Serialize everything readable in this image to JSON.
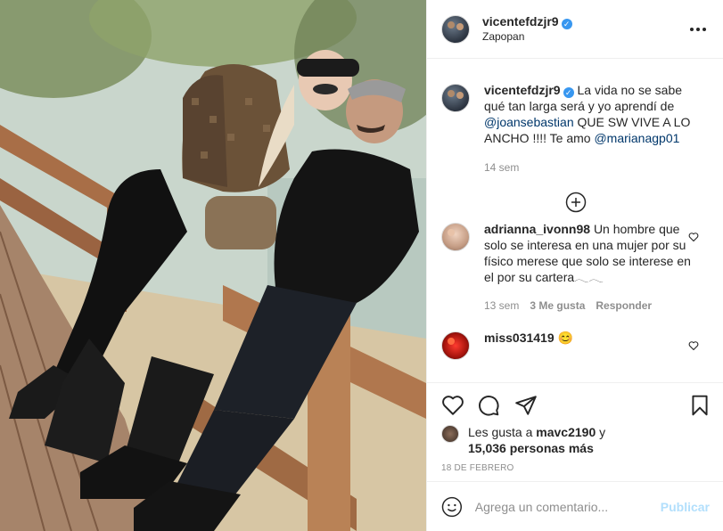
{
  "post": {
    "username": "vicentefdzjr9",
    "location": "Zapopan",
    "verified": true
  },
  "caption": {
    "username": "vicentefdzjr9",
    "text_1": "La vida no se sabe qué tan larga será y yo aprendí de ",
    "mention_1": "@joansebastian",
    "text_2": " QUE SW VIVE A LO ANCHO !!!! Te amo ",
    "mention_2": "@marianagp01",
    "time": "14 sem"
  },
  "comments": [
    {
      "username": "adrianna_ivonn98",
      "text": "Un hombre que solo se interesa en una mujer por su físico merese que solo se interese en el por su cartera𓂃𓂃",
      "time": "13 sem",
      "likes": "3 Me gusta",
      "reply": "Responder"
    },
    {
      "username": "miss031419",
      "text": "😊"
    }
  ],
  "likes": {
    "prefix": "Les gusta a ",
    "user": "mavc2190",
    "mid": " y",
    "count": "15,036 personas más"
  },
  "date": "18 DE FEBRERO",
  "add_comment": {
    "placeholder": "Agrega un comentario...",
    "publish": "Publicar"
  },
  "icons": {
    "more": "more-options-icon",
    "verified": "verified-badge-icon",
    "load_more": "load-more-icon",
    "like": "heart-icon",
    "comment": "comment-icon",
    "share": "share-icon",
    "save": "bookmark-icon",
    "emoji": "emoji-icon"
  },
  "colors": {
    "verified": "#3897f0",
    "mention": "#00376b",
    "publish_disabled": "#b2dffc",
    "muted": "#8e8e8e"
  }
}
